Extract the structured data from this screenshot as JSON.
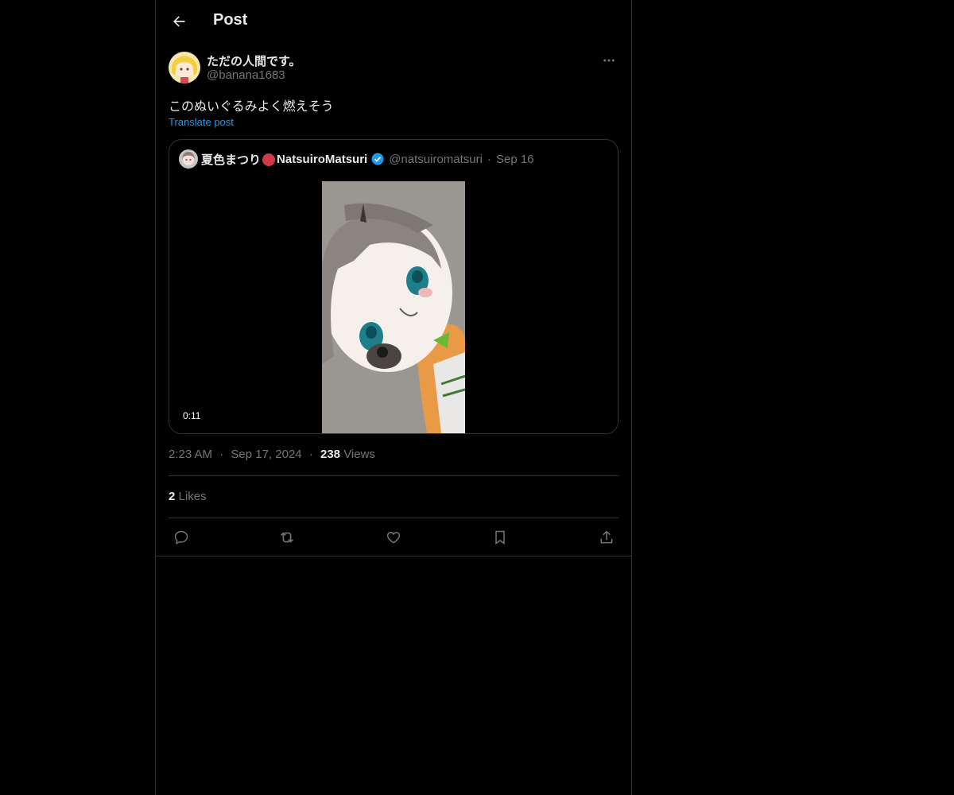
{
  "header": {
    "title": "Post",
    "back_icon": "arrow-left-icon"
  },
  "post": {
    "author": {
      "name": "ただの人間です。",
      "handle": "@banana1683"
    },
    "text": "このぬいぐるみよく燃えそう",
    "translate_label": "Translate post",
    "quoted": {
      "name": "夏色まつり",
      "name_suffix": "NatsuiroMatsuri",
      "handle": "@natsuiromatsuri",
      "separator": "·",
      "date": "Sep 16",
      "video_duration": "0:11"
    },
    "meta": {
      "time": "2:23 AM",
      "separator": "·",
      "date": "Sep 17, 2024",
      "views_count": "238",
      "views_label": "Views"
    },
    "likes": {
      "count": "2",
      "label": "Likes"
    },
    "actions": [
      "reply-icon",
      "repost-icon",
      "like-icon",
      "bookmark-icon",
      "share-icon"
    ]
  },
  "colors": {
    "background": "#000000",
    "text": "#e7e9ea",
    "muted": "#71767b",
    "accent": "#1d9bf0",
    "border": "#2f3336"
  }
}
